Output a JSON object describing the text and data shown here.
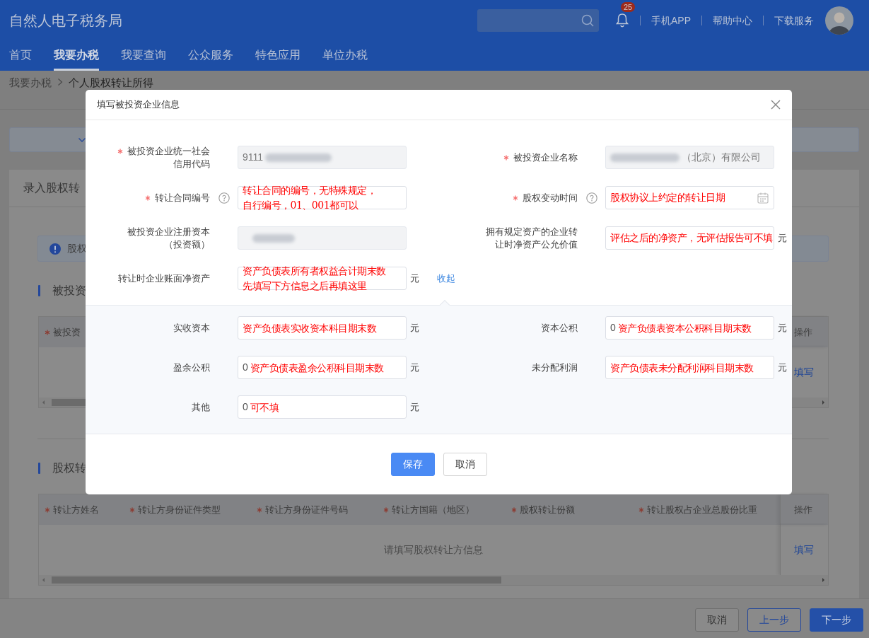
{
  "app": {
    "title": "自然人电子税务局"
  },
  "header": {
    "notification_count": "25",
    "links": [
      "手机APP",
      "帮助中心",
      "下载服务"
    ]
  },
  "nav": [
    {
      "label": "首页",
      "selected": false
    },
    {
      "label": "我要办税",
      "selected": true
    },
    {
      "label": "我要查询",
      "selected": false
    },
    {
      "label": "公众服务",
      "selected": false
    },
    {
      "label": "特色应用",
      "selected": false
    },
    {
      "label": "单位办税",
      "selected": false
    }
  ],
  "breadcrumb": [
    "我要办税",
    "个人股权转让所得"
  ],
  "page": {
    "card_title": "录入股权转",
    "alert": "股权",
    "sections": [
      {
        "title": "被投资",
        "table": {
          "columns": [
            {
              "label": "被投资",
              "required": true
            }
          ],
          "action_header": "操作",
          "action": "填写"
        }
      },
      {
        "title": "股权转",
        "table": {
          "columns": [
            {
              "label": "转让方姓名",
              "required": true
            },
            {
              "label": "转让方身份证件类型",
              "required": true
            },
            {
              "label": "转让方身份证件号码",
              "required": true
            },
            {
              "label": "转让方国籍（地区）",
              "required": true
            },
            {
              "label": "股权转让份额",
              "required": true
            },
            {
              "label": "转让股权占企业总股份比重",
              "required": true
            }
          ],
          "action_header": "操作",
          "empty_text": "请填写股权转让方信息",
          "action": "填写"
        }
      }
    ]
  },
  "footer": {
    "buttons": [
      {
        "label": "取消",
        "kind": "default"
      },
      {
        "label": "上一步",
        "kind": "outline"
      },
      {
        "label": "下一步",
        "kind": "primary"
      }
    ]
  },
  "dialog": {
    "title": "填写被投资企业信息",
    "fields": [
      {
        "label_lines": [
          "被投资企业统一社会",
          "信用代码"
        ],
        "required": true,
        "disabled": true,
        "value": "9111",
        "blur_after": true
      },
      {
        "label_lines": [
          "被投资企业名称"
        ],
        "required": true,
        "disabled": true,
        "value": "（北京）有限公司",
        "blur_before": true
      },
      {
        "label_lines": [
          "转让合同编号"
        ],
        "required": true,
        "help": true,
        "disabled": false,
        "note_lines": [
          "转让合同的编号，无特殊规定，",
          "自行编号，01、001都可以"
        ]
      },
      {
        "label_lines": [
          "股权变动时间"
        ],
        "required": true,
        "help": true,
        "disabled": false,
        "kind": "date",
        "note_lines": [
          "股权协议上约定的转让日期"
        ]
      },
      {
        "label_lines": [
          "被投资企业注册资本",
          "（投资额）"
        ],
        "required": false,
        "disabled": true,
        "blur_before": true
      },
      {
        "label_lines": [
          "拥有规定资产的企业转",
          "让时净资产公允价值"
        ],
        "required": false,
        "disabled": false,
        "note_lines": [
          "评估之后的净资产，无评估报告可不填"
        ],
        "unit": "元"
      },
      {
        "label_lines": [
          "转让时企业账面净资产"
        ],
        "required": false,
        "disabled": false,
        "note_lines": [
          "资产负债表所有者权益合计期末数",
          "先填写下方信息之后再填这里"
        ],
        "unit": "元",
        "link": "收起"
      }
    ],
    "detail_fields": [
      {
        "label_lines": [
          "实收资本"
        ],
        "note_lines": [
          "资产负债表实收资本科目期末数"
        ],
        "unit": "元"
      },
      {
        "label_lines": [
          "资本公积"
        ],
        "value": "0",
        "note_lines": [
          "资产负债表资本公积科目期末数"
        ],
        "unit": "元"
      },
      {
        "label_lines": [
          "盈余公积"
        ],
        "value": "0",
        "note_lines": [
          "资产负债表盈余公积科目期末数"
        ],
        "unit": "元"
      },
      {
        "label_lines": [
          "未分配利润"
        ],
        "note_lines": [
          "资产负债表未分配利润科目期末数"
        ],
        "unit": "元"
      },
      {
        "label_lines": [
          "其他"
        ],
        "value": "0",
        "note_lines": [
          "可不填"
        ],
        "unit": "元"
      }
    ],
    "buttons": [
      {
        "label": "保存",
        "kind": "primary"
      },
      {
        "label": "取消",
        "kind": "default"
      }
    ]
  }
}
